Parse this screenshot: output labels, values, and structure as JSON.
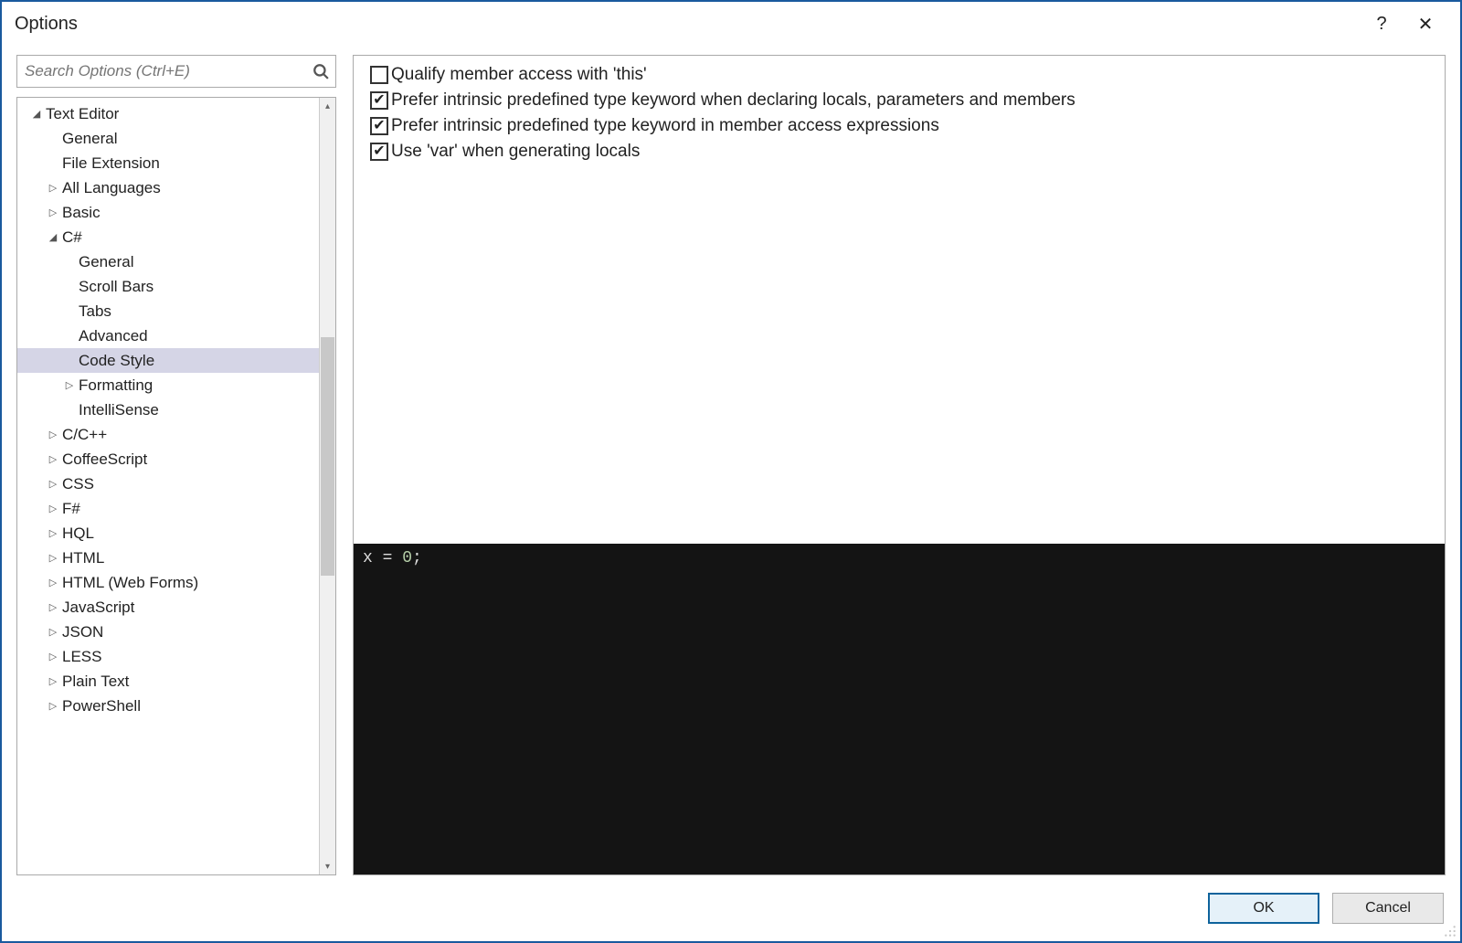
{
  "window": {
    "title": "Options",
    "helpGlyph": "?",
    "closeGlyph": "✕"
  },
  "search": {
    "placeholder": "Search Options (Ctrl+E)"
  },
  "tree": [
    {
      "label": "Text Editor",
      "indent": 0,
      "toggle": "expanded"
    },
    {
      "label": "General",
      "indent": 1,
      "toggle": "none"
    },
    {
      "label": "File Extension",
      "indent": 1,
      "toggle": "none"
    },
    {
      "label": "All Languages",
      "indent": 1,
      "toggle": "collapsed"
    },
    {
      "label": "Basic",
      "indent": 1,
      "toggle": "collapsed"
    },
    {
      "label": "C#",
      "indent": 1,
      "toggle": "expanded"
    },
    {
      "label": "General",
      "indent": 2,
      "toggle": "none"
    },
    {
      "label": "Scroll Bars",
      "indent": 2,
      "toggle": "none"
    },
    {
      "label": "Tabs",
      "indent": 2,
      "toggle": "none"
    },
    {
      "label": "Advanced",
      "indent": 2,
      "toggle": "none"
    },
    {
      "label": "Code Style",
      "indent": 2,
      "toggle": "none",
      "selected": true
    },
    {
      "label": "Formatting",
      "indent": 2,
      "toggle": "collapsed"
    },
    {
      "label": "IntelliSense",
      "indent": 2,
      "toggle": "none"
    },
    {
      "label": "C/C++",
      "indent": 1,
      "toggle": "collapsed"
    },
    {
      "label": "CoffeeScript",
      "indent": 1,
      "toggle": "collapsed"
    },
    {
      "label": "CSS",
      "indent": 1,
      "toggle": "collapsed"
    },
    {
      "label": "F#",
      "indent": 1,
      "toggle": "collapsed"
    },
    {
      "label": "HQL",
      "indent": 1,
      "toggle": "collapsed"
    },
    {
      "label": "HTML",
      "indent": 1,
      "toggle": "collapsed"
    },
    {
      "label": "HTML (Web Forms)",
      "indent": 1,
      "toggle": "collapsed"
    },
    {
      "label": "JavaScript",
      "indent": 1,
      "toggle": "collapsed"
    },
    {
      "label": "JSON",
      "indent": 1,
      "toggle": "collapsed"
    },
    {
      "label": "LESS",
      "indent": 1,
      "toggle": "collapsed"
    },
    {
      "label": "Plain Text",
      "indent": 1,
      "toggle": "collapsed"
    },
    {
      "label": "PowerShell",
      "indent": 1,
      "toggle": "collapsed"
    }
  ],
  "checks": [
    {
      "checked": false,
      "label": "Qualify member access with 'this'"
    },
    {
      "checked": true,
      "label": "Prefer intrinsic predefined type keyword when declaring locals, parameters and members"
    },
    {
      "checked": true,
      "label": "Prefer intrinsic predefined type keyword in member access expressions"
    },
    {
      "checked": true,
      "label": "Use 'var' when generating locals"
    }
  ],
  "code": {
    "prefix": "x = ",
    "number": "0",
    "suffix": ";"
  },
  "buttons": {
    "ok": "OK",
    "cancel": "Cancel"
  }
}
